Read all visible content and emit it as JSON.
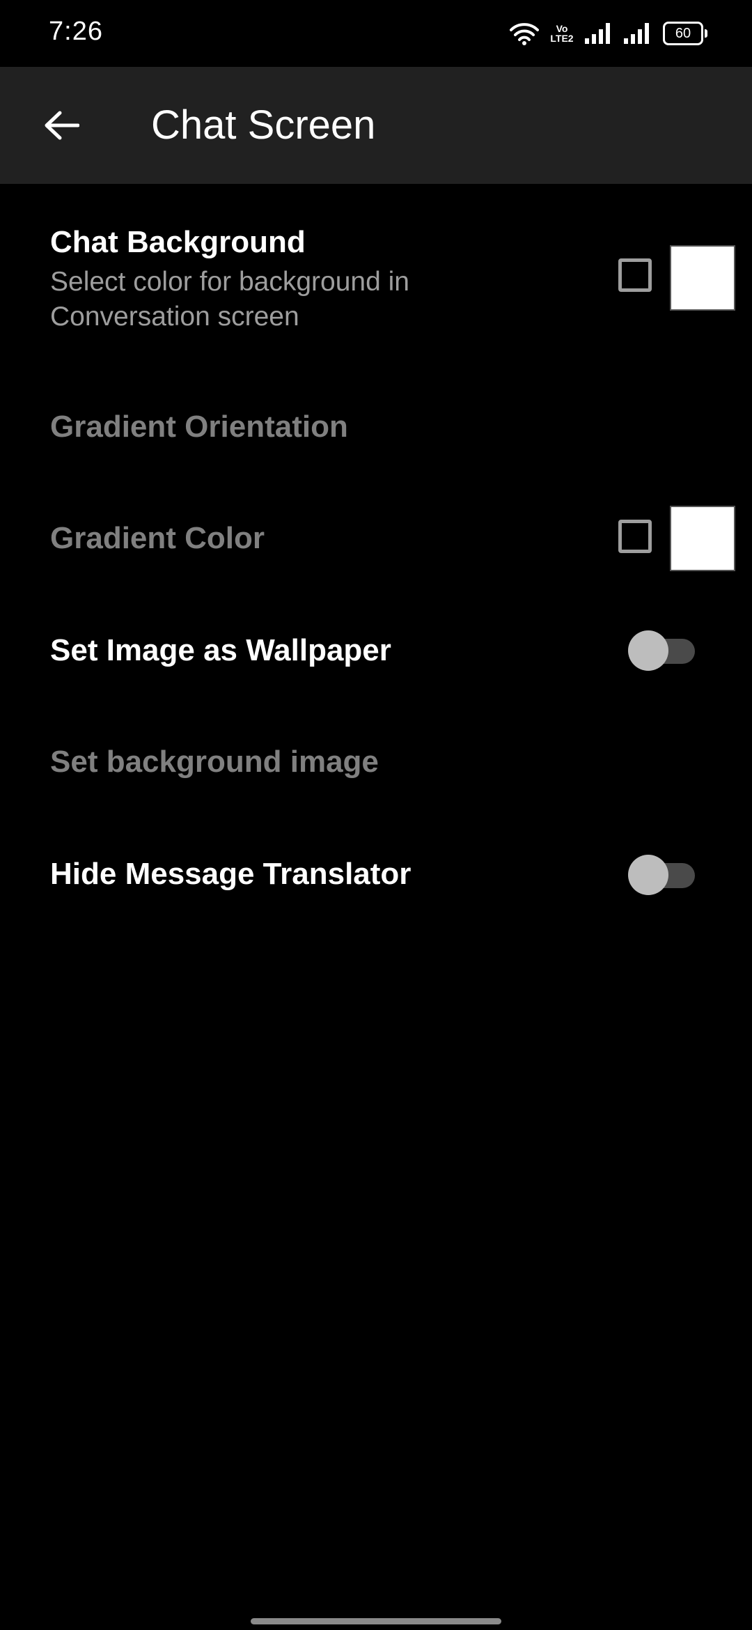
{
  "status_bar": {
    "time": "7:26",
    "icons": [
      "wifi-icon",
      "volte-icon",
      "signal-icon",
      "signal-icon",
      "battery-icon"
    ],
    "volte_line1": "Vo",
    "volte_line2": "LTE2",
    "battery_level": "60"
  },
  "toolbar": {
    "back_icon": "arrow-left-icon",
    "title": "Chat Screen"
  },
  "settings": {
    "chat_background": {
      "title": "Chat Background",
      "summary": "Select color for background in Conversation screen",
      "checked": false,
      "color": "#FFFFFF"
    },
    "gradient_orientation": {
      "title": "Gradient Orientation",
      "enabled": false
    },
    "gradient_color": {
      "title": "Gradient Color",
      "enabled": false,
      "checked": false,
      "color": "#FFFFFF"
    },
    "set_image_wallpaper": {
      "title": "Set Image as Wallpaper",
      "on": false
    },
    "set_background_image": {
      "title": "Set background image",
      "enabled": false
    },
    "hide_message_translator": {
      "title": "Hide Message Translator",
      "on": false
    }
  },
  "colors": {
    "background": "#000000",
    "toolbar": "#212121",
    "text_primary": "#FFFFFF",
    "text_disabled": "#808080",
    "text_secondary": "#9E9E9E"
  }
}
